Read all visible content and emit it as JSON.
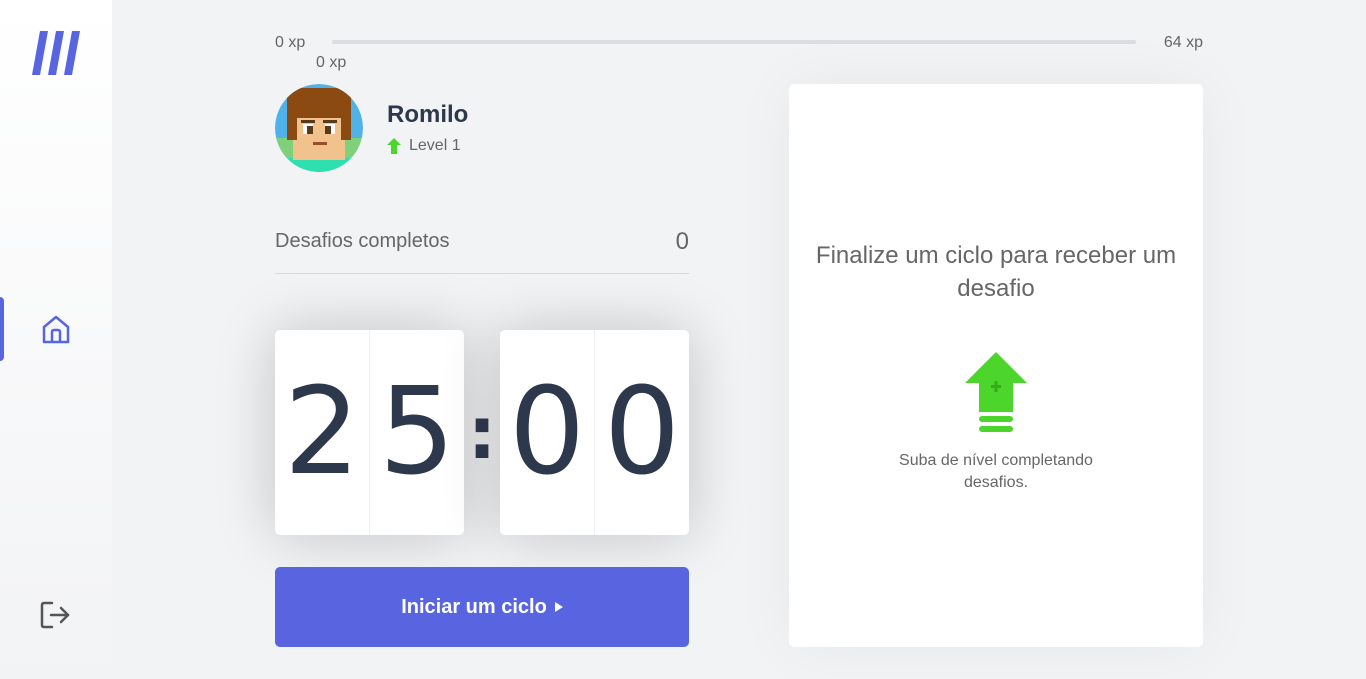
{
  "sidebar": {
    "logo_icon": "move-it-logo",
    "nav": [
      {
        "icon": "home-icon",
        "active": true
      }
    ],
    "logout_icon": "logout-icon",
    "accent": "#5965e0"
  },
  "xp": {
    "min_label": "0 xp",
    "max_label": "64 xp",
    "current_label": "0 xp",
    "progress_fraction": 0
  },
  "profile": {
    "name": "Romilo",
    "level_label": "Level 1",
    "level_icon": "level-up-arrow-icon"
  },
  "challenges": {
    "label": "Desafios completos",
    "count": "0"
  },
  "countdown": {
    "minute_left": "2",
    "minute_right": "5",
    "separator": ":",
    "second_left": "0",
    "second_right": "0"
  },
  "start_button": {
    "label": "Iniciar um ciclo",
    "icon": "play-icon",
    "color": "#5965e0"
  },
  "challenge_box": {
    "title": "Finalize um ciclo para receber um desafio",
    "icon": "level-up-icon",
    "text": "Suba de nível completando desafios."
  },
  "colors": {
    "green": "#4cd62b",
    "text_dark": "#2e384d",
    "text": "#666666",
    "background": "#f2f3f5"
  }
}
